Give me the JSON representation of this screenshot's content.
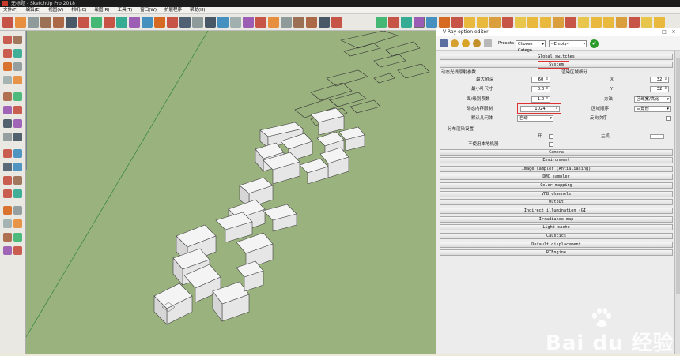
{
  "window": {
    "title": "无标题 - SketchUp Pro 2018"
  },
  "menu": [
    "文件(F)",
    "编辑(E)",
    "视图(V)",
    "相机(C)",
    "绘图(R)",
    "工具(T)",
    "窗口(W)",
    "扩展程序",
    "帮助(H)"
  ],
  "icons": {
    "toolbar": [
      "select-icon",
      "eraser-icon",
      "pencil-icon",
      "arc-icon",
      "rectangle-icon",
      "pushpull-icon",
      "move-icon",
      "rotate-icon",
      "scale-icon",
      "offset-icon",
      "tape-icon",
      "text-icon",
      "axes-icon",
      "paint-icon",
      "orbit-icon",
      "pan-icon",
      "zoom-icon",
      "zoom-extents-icon",
      "xray-icon",
      "wireframe-icon",
      "hidden-line-icon",
      "shaded-icon",
      "textured-icon",
      "monochrome-icon",
      "iso-view-icon",
      "top-view-icon",
      "front-view-icon",
      "right-view-icon",
      "back-view-icon",
      "left-view-icon",
      "select-icon",
      "component-icon",
      "paint-icon",
      "eraser-icon",
      "vray-sphere-icon",
      "vray-render-icon",
      "vray-interactive-icon",
      "vray-frame-buffer-icon",
      "vray-light-icon",
      "vray-sphere-light-icon",
      "vray-spot-icon",
      "vray-ies-icon",
      "vray-omni-icon",
      "vray-dome-icon",
      "vray-mesh-icon",
      "vray-proxy-icon",
      "vray-fur-icon",
      "vray-plane-icon",
      "vray-camera-icon",
      "vray-sun-icon"
    ]
  },
  "vray": {
    "title": "V-Ray option editor",
    "presets_label": "Presets",
    "preset_category": "Choose Catego",
    "preset_value": "--Empty--",
    "sections_top": [
      "Global switches",
      "System"
    ],
    "system": {
      "left_header": "动态光线原射参数",
      "right_header": "渲染区域细分",
      "max_depth_label": "最大树深",
      "max_depth_value": "60",
      "min_leaf_label": "最小叶尺寸",
      "min_leaf_value": "0.0",
      "face_coef_label": "面/级别系数",
      "face_coef_value": "1.0",
      "mem_limit_label": "动态内存限制",
      "mem_limit_value": "1024",
      "default_geom_label": "默认几何体",
      "default_geom_value": "自动",
      "x_label": "X",
      "x_value": "32",
      "y_label": "Y",
      "y_value": "32",
      "method_label": "方法",
      "method_value": "区域宽/高比",
      "region_seq_label": "区域顺序",
      "region_seq_value": "三角形",
      "reverse_label": "反向次序",
      "distributed_header": "分布渲染设置",
      "on_label": "开",
      "host_label": "主机",
      "no_local_label": "不使用本地机器"
    },
    "sections_bottom": [
      "Camera",
      "Environment",
      "Image sampler (Antialiasing)",
      "DMC sampler",
      "Color mapping",
      "VFB channels",
      "Output",
      "Indirect illumination (GI)",
      "Irradiance map",
      "Light cache",
      "Caustics",
      "Default displacement",
      "RTEngine"
    ]
  },
  "watermark": {
    "text": "Bai du 经验"
  },
  "colors": {
    "viewport": "#9ab27e",
    "highlight": "#e03030",
    "ok": "#2a9a2a"
  }
}
